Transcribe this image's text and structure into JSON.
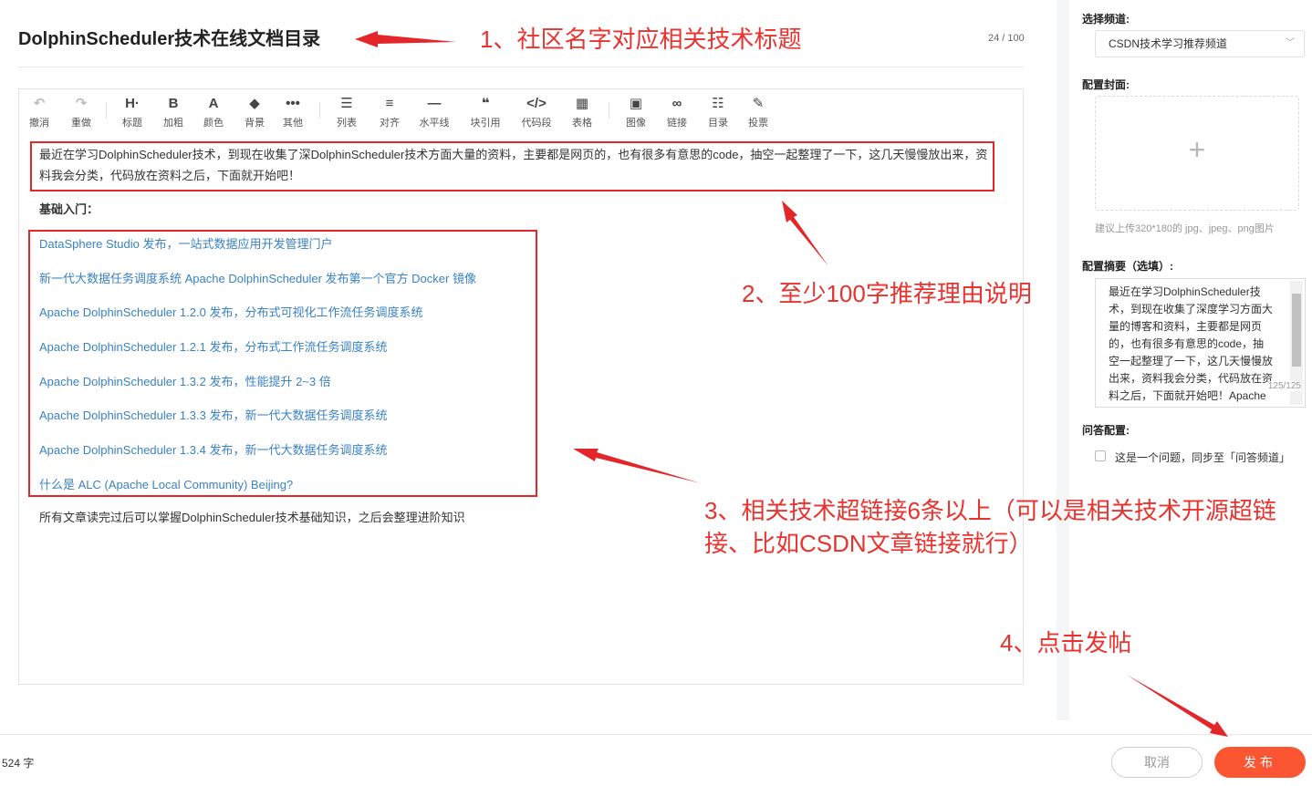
{
  "title": {
    "value": "DolphinScheduler技术在线文档目录",
    "count": "24 / 100"
  },
  "toolbar": [
    {
      "icon": "undo-icon",
      "glyph": "↶",
      "label": "撤消",
      "dim": true
    },
    {
      "icon": "redo-icon",
      "glyph": "↷",
      "label": "重做",
      "dim": true
    },
    {
      "icon": "heading-icon",
      "glyph": "H·",
      "label": "标题"
    },
    {
      "icon": "bold-icon",
      "glyph": "B",
      "label": "加粗"
    },
    {
      "icon": "font-color-icon",
      "glyph": "A",
      "label": "颜色"
    },
    {
      "icon": "background-icon",
      "glyph": "◆",
      "label": "背景"
    },
    {
      "icon": "more-icon",
      "glyph": "•••",
      "label": "其他"
    },
    {
      "icon": "list-icon",
      "glyph": "☰",
      "label": "列表"
    },
    {
      "icon": "align-icon",
      "glyph": "≡",
      "label": "对齐"
    },
    {
      "icon": "horizontal-line-icon",
      "glyph": "—",
      "label": "水平线"
    },
    {
      "icon": "quote-icon",
      "glyph": "❝",
      "label": "块引用"
    },
    {
      "icon": "code-icon",
      "glyph": "</>",
      "label": "代码段"
    },
    {
      "icon": "table-icon",
      "glyph": "▦",
      "label": "表格"
    },
    {
      "icon": "image-icon",
      "glyph": "▣",
      "label": "图像"
    },
    {
      "icon": "link-icon",
      "glyph": "∞",
      "label": "链接"
    },
    {
      "icon": "toc-icon",
      "glyph": "☷",
      "label": "目录"
    },
    {
      "icon": "vote-icon",
      "glyph": "✎",
      "label": "投票"
    }
  ],
  "content": {
    "intro": "最近在学习DolphinScheduler技术，到现在收集了深DolphinScheduler技术方面大量的资料，主要都是网页的，也有很多有意思的code，抽空一起整理了一下，这几天慢慢放出来，资料我会分类，代码放在资料之后，下面就开始吧！",
    "section_heading": "基础入门：",
    "links": [
      "DataSphere Studio 发布，一站式数据应用开发管理门户",
      "新一代大数据任务调度系统 Apache DolphinScheduler 发布第一个官方 Docker 镜像",
      "Apache DolphinScheduler 1.2.0 发布，分布式可视化工作流任务调度系统",
      "Apache DolphinScheduler 1.2.1 发布，分布式工作流任务调度系统",
      "Apache DolphinScheduler 1.3.2 发布，性能提升 2~3 倍",
      "Apache DolphinScheduler 1.3.3 发布，新一代大数据任务调度系统",
      "Apache DolphinScheduler 1.3.4 发布，新一代大数据任务调度系统",
      "什么是 ALC (Apache Local Community) Beijing?"
    ],
    "footer": "所有文章读完过后可以掌握DolphinScheduler技术基础知识，之后会整理进阶知识"
  },
  "sidebar": {
    "channel_label": "选择频道:",
    "channel_value": "CSDN技术学习推荐频道",
    "cover_label": "配置封面:",
    "cover_hint": "建议上传320*180的 jpg、jpeg、png图片",
    "abstract_label": "配置摘要（选填）:",
    "abstract_text": "最近在学习DolphinScheduler技术，到现在收集了深度学习方面大量的博客和资料，主要都是网页的，也有很多有意思的code，抽空一起整理了一下，这几天慢慢放出来，资料我会分类，代码放在资料之后，下面就开始吧！Apache DolphinS...",
    "abstract_count": "125/125",
    "qa_label": "问答配置:",
    "qa_checkbox_text": "这是一个问题，同步至「问答频道」"
  },
  "bottom": {
    "word_count": "524 字",
    "cancel_label": "取消",
    "publish_label": "发布"
  },
  "annotations": {
    "step1": "1、社区名字对应相关技术标题",
    "step2": "2、至少100字推荐理由说明",
    "step3_line1": "3、相关技术超链接6条以上（可以是相关技术开源超链",
    "step3_line2": "接、比如CSDN文章链接就行）",
    "step4": "4、点击发帖",
    "color": "#e8332f"
  }
}
